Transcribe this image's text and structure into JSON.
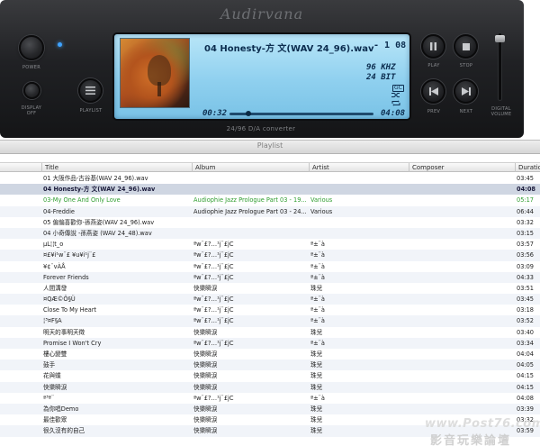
{
  "player": {
    "logo": "Audirvana",
    "captions": {
      "power": "POWER",
      "display_off": "DISPLAY\nOFF",
      "playlist": "PLAYLIST",
      "play": "PLAY",
      "stop": "STOP",
      "prev": "PREV",
      "next": "NEXT",
      "volume": "DIGITAL\nVOLUME"
    },
    "converter": "24/96 D/A converter",
    "volume_level": 0.98
  },
  "display": {
    "track_title": "04 Honesty-方 文(WAV 24_96).wav",
    "time_remaining": "- 1 08",
    "sample_rate": "96 KHZ",
    "bit_depth": "24 BIT",
    "mode_badge": "GC",
    "elapsed": "00:32",
    "total": "04:08",
    "progress": 0.13,
    "icons": [
      "shuffle-icon",
      "repeat-icon"
    ]
  },
  "playlist": {
    "window_title": "Playlist",
    "columns": [
      "Title",
      "Album",
      "Artist",
      "Composer",
      "Duration"
    ],
    "rows": [
      {
        "title": "01 大阪作品-古谷基(WAV 24_96).wav",
        "album": "",
        "artist": "",
        "composer": "",
        "duration": "03:45",
        "state": ""
      },
      {
        "title": "04 Honesty-方 文(WAV 24_96).wav",
        "album": "",
        "artist": "",
        "composer": "",
        "duration": "04:08",
        "state": "selected"
      },
      {
        "title": "03-My One And Only Love",
        "album": "Audiophie Jazz Prologue Part 03 - 19...",
        "artist": "Various",
        "composer": "",
        "duration": "05:17",
        "state": "green"
      },
      {
        "title": "04-Freddie",
        "album": "Audiophie Jazz Prologue Part 03 - 24...",
        "artist": "Various",
        "composer": "",
        "duration": "06:44",
        "state": ""
      },
      {
        "title": "05 偏偏喜歡你-孫燕姿(WAV 24_96).wav",
        "album": "",
        "artist": "",
        "composer": "",
        "duration": "03:32",
        "state": ""
      },
      {
        "title": "04 小奇傳說 -孫燕姿 (WAV 24_48).wav",
        "album": "",
        "artist": "",
        "composer": "",
        "duration": "03:15",
        "state": ""
      },
      {
        "title": "μL¦¦t_o",
        "album": "ªw¨£?…¹j¨£jC",
        "artist": "ª±¨à",
        "composer": "",
        "duration": "03:57",
        "state": ""
      },
      {
        "title": "¤£¥i¹w¨£ ¥u¥i¹j¨£",
        "album": "ªw¨£?…¹j¨£jC",
        "artist": "ª±¨à",
        "composer": "",
        "duration": "03:56",
        "state": ""
      },
      {
        "title": "¥¢¨vÀÅ",
        "album": "ªw¨£?…¹j¨£jC",
        "artist": "ª±¨à",
        "composer": "",
        "duration": "03:09",
        "state": ""
      },
      {
        "title": "Forever Friends",
        "album": "ªw¨£?…¹j¨£jC",
        "artist": "ª±¨à",
        "composer": "",
        "duration": "04:33",
        "state": ""
      },
      {
        "title": "人間溝發",
        "album": "快樂瞬淚",
        "artist": "珠兒",
        "composer": "",
        "duration": "03:51",
        "state": ""
      },
      {
        "title": "¤QÆ©Ö§Ü",
        "album": "ªw¨£?…¹j¨£jC",
        "artist": "ª±¨à",
        "composer": "",
        "duration": "03:45",
        "state": ""
      },
      {
        "title": "Close To My Heart",
        "album": "ªw¨£?…¹j¨£jC",
        "artist": "ª±¨à",
        "composer": "",
        "duration": "03:18",
        "state": ""
      },
      {
        "title": "¦³¤F§A",
        "album": "ªw¨£?…¹j¨£jC",
        "artist": "ª±¨à",
        "composer": "",
        "duration": "03:52",
        "state": ""
      },
      {
        "title": "明天的事明天徵",
        "album": "快樂瞬淚",
        "artist": "珠兒",
        "composer": "",
        "duration": "03:40",
        "state": ""
      },
      {
        "title": "Promise I Won't Cry",
        "album": "ªw¨£?…¹j¨£jC",
        "artist": "ª±¨à",
        "composer": "",
        "duration": "03:34",
        "state": ""
      },
      {
        "title": "樓心變雙",
        "album": "快樂瞬淚",
        "artist": "珠兒",
        "composer": "",
        "duration": "04:04",
        "state": ""
      },
      {
        "title": "鼓手",
        "album": "快樂瞬淚",
        "artist": "珠兒",
        "composer": "",
        "duration": "04:05",
        "state": ""
      },
      {
        "title": "花與蝶",
        "album": "快樂瞬淚",
        "artist": "珠兒",
        "composer": "",
        "duration": "04:15",
        "state": ""
      },
      {
        "title": "快樂瞬淚",
        "album": "快樂瞬淚",
        "artist": "珠兒",
        "composer": "",
        "duration": "04:15",
        "state": ""
      },
      {
        "title": "ª³ª¨",
        "album": "ªw¨£?…¹j¨£jC",
        "artist": "ª±¨à",
        "composer": "",
        "duration": "04:08",
        "state": ""
      },
      {
        "title": "為你唱Demo",
        "album": "快樂瞬淚",
        "artist": "珠兒",
        "composer": "",
        "duration": "03:39",
        "state": ""
      },
      {
        "title": "最佳歡眾",
        "album": "快樂瞬淚",
        "artist": "珠兒",
        "composer": "",
        "duration": "03:32",
        "state": ""
      },
      {
        "title": "很久沒有的自己",
        "album": "快樂瞬淚",
        "artist": "珠兒",
        "composer": "",
        "duration": "03:59",
        "state": ""
      }
    ]
  },
  "watermark": {
    "url": "www.Post76.com",
    "text": "影音玩樂論壇"
  }
}
